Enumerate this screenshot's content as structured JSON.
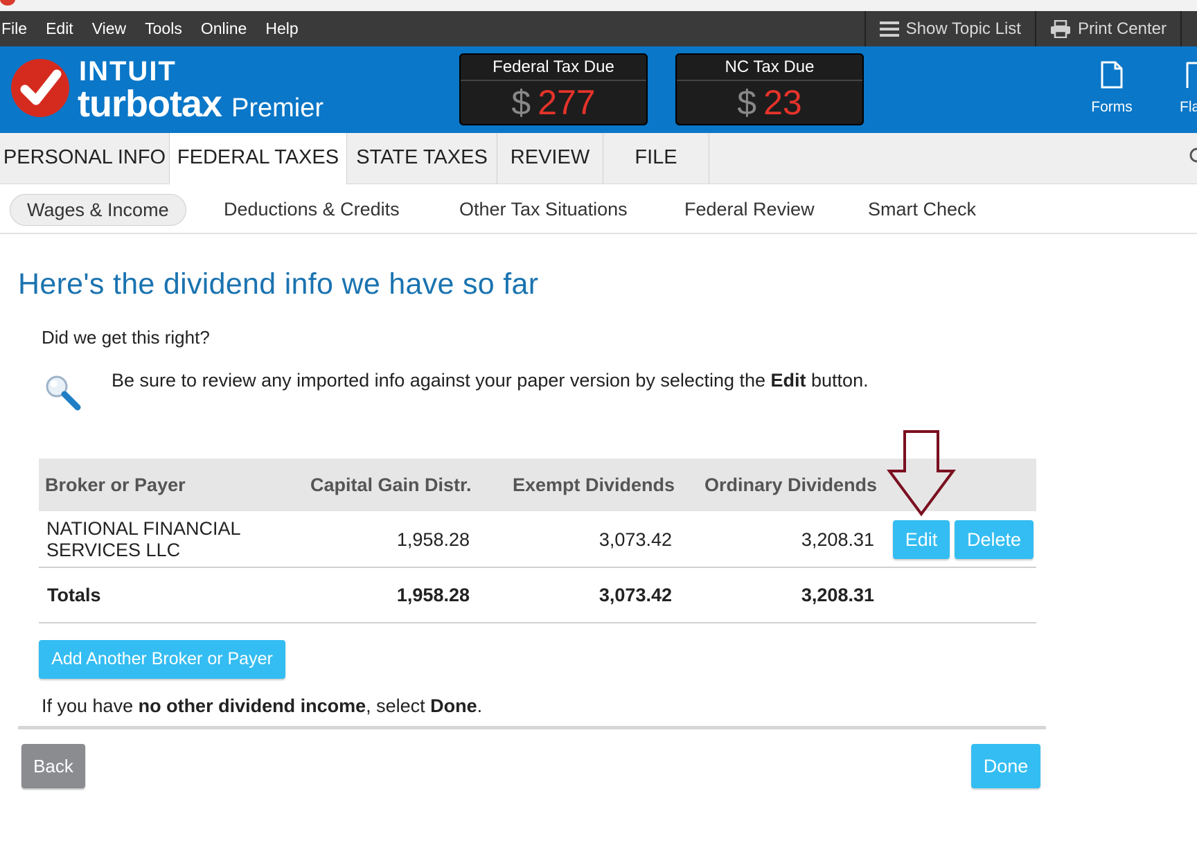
{
  "menubar": {
    "items": [
      "File",
      "Edit",
      "View",
      "Tools",
      "Online",
      "Help"
    ],
    "show_topic_list": "Show Topic List",
    "print_center": "Print Center"
  },
  "header": {
    "brand_line1": "INTUIT",
    "brand_line2": "turbotax",
    "edition": "Premier",
    "federal": {
      "label": "Federal Tax Due",
      "currency": "$",
      "amount": "277"
    },
    "state": {
      "label": "NC Tax Due",
      "currency": "$",
      "amount": "23"
    },
    "forms_label": "Forms",
    "cut_label": "Fla"
  },
  "tabs": [
    "PERSONAL INFO",
    "FEDERAL TAXES",
    "STATE TAXES",
    "REVIEW",
    "FILE"
  ],
  "active_tab": "FEDERAL TAXES",
  "subtabs": [
    "Wages & Income",
    "Deductions & Credits",
    "Other Tax Situations",
    "Federal Review",
    "Smart Check"
  ],
  "active_subtab": "Wages & Income",
  "page": {
    "title": "Here's the dividend info we have so far",
    "question": "Did we get this right?",
    "tip_before": "Be sure to review any imported info against your paper version by selecting the ",
    "tip_bold": "Edit",
    "tip_after": " button."
  },
  "table": {
    "headers": [
      "Broker or Payer",
      "Capital Gain Distr.",
      "Exempt Dividends",
      "Ordinary Dividends"
    ],
    "rows": [
      {
        "payer_line1": "NATIONAL FINANCIAL",
        "payer_line2": "SERVICES LLC",
        "capital_gain": "1,958.28",
        "exempt": "3,073.42",
        "ordinary": "3,208.31"
      }
    ],
    "totals": {
      "label": "Totals",
      "capital_gain": "1,958.28",
      "exempt": "3,073.42",
      "ordinary": "3,208.31"
    },
    "edit_label": "Edit",
    "delete_label": "Delete"
  },
  "add_button": "Add Another Broker or Payer",
  "final": {
    "before": "If you have ",
    "bold1": "no other dividend income",
    "middle": ", select ",
    "bold2": "Done",
    "after": "."
  },
  "nav": {
    "back": "Back",
    "done": "Done"
  },
  "colors": {
    "header_blue": "#0a77c8",
    "button_blue": "#34bdf2",
    "title_blue": "#1a73b0",
    "tax_red": "#e5332a",
    "arrow": "#7a1020"
  }
}
